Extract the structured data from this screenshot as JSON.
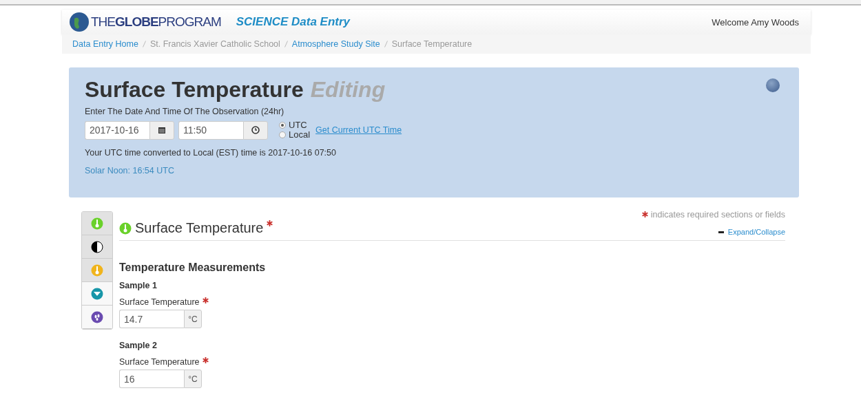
{
  "navbar": {
    "logo": "THE**GLOBE**PROGRAM",
    "app_title": "SCIENCE Data Entry",
    "welcome": "Welcome Amy Woods"
  },
  "breadcrumb": [
    {
      "label": "Data Entry Home",
      "kind": "link"
    },
    {
      "label": "St. Francis Xavier Catholic School",
      "kind": "text"
    },
    {
      "label": "Atmosphere Study Site",
      "kind": "link"
    },
    {
      "label": "Surface Temperature",
      "kind": "text"
    }
  ],
  "header": {
    "title": "Surface Temperature",
    "status": "Editing",
    "prompt": "Enter The Date And Time Of The Observation (24hr)",
    "date": "2017-10-16",
    "time": "11:50",
    "zones": [
      {
        "label": "UTC",
        "selected": true
      },
      {
        "label": "Local",
        "selected": false
      }
    ],
    "current_time_link": "Get Current UTC Time",
    "conversion": "Your UTC time converted to Local (EST) time is 2017-10-16 07:50",
    "solar_noon": "Solar Noon: 16:54 UTC"
  },
  "side_nav": [
    {
      "kind": "thermo-green",
      "highlighted": true
    },
    {
      "kind": "half-circle",
      "highlighted": true
    },
    {
      "kind": "thermo-yellow",
      "highlighted": true
    },
    {
      "kind": "funnel",
      "highlighted": false
    },
    {
      "kind": "drops",
      "highlighted": false
    }
  ],
  "required_note": "indicates required sections or fields",
  "expand_link": "Expand/Collapse",
  "section": {
    "title": "Surface Temperature",
    "subtitle": "Temperature Measurements",
    "samples": [
      {
        "title": "Sample 1",
        "label": "Surface Temperature",
        "value": "14.7",
        "unit": "°C"
      },
      {
        "title": "Sample 2",
        "label": "Surface Temperature",
        "value": "16",
        "unit": "°C"
      }
    ]
  }
}
